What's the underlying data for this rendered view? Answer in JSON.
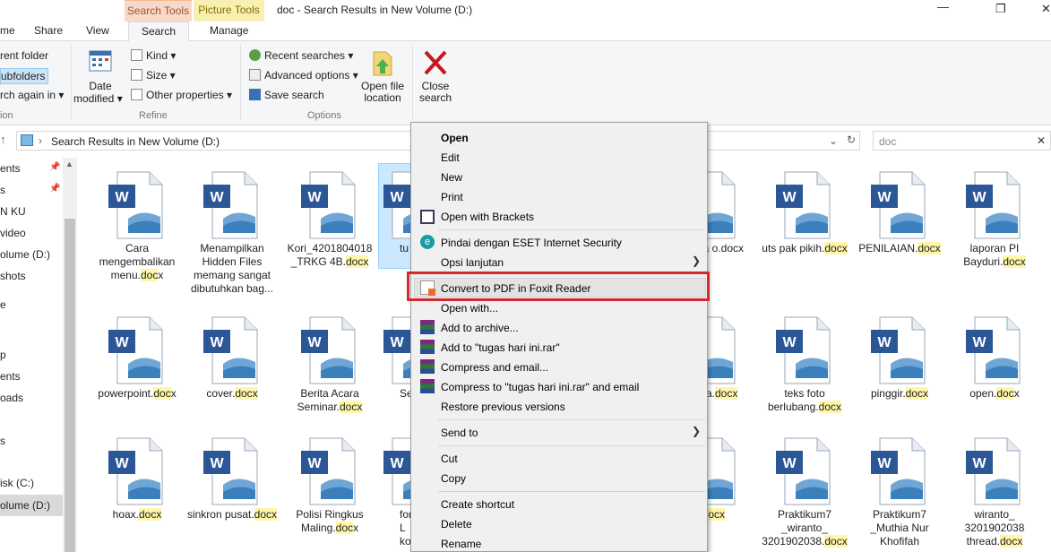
{
  "window": {
    "title": "doc - Search Results in New Volume (D:)",
    "context_tabs": [
      "Search Tools",
      "Picture Tools"
    ]
  },
  "ribbon_tabs": [
    "me",
    "Share",
    "View",
    "Search",
    "Manage"
  ],
  "ribbon": {
    "left_items": [
      "rent folder",
      "ubfolders",
      "rch again in"
    ],
    "left_group": "ion",
    "date_modified": [
      "Date",
      "modified"
    ],
    "refine": [
      "Kind",
      "Size",
      "Other properties"
    ],
    "refine_label": "Refine",
    "options": [
      "Recent searches",
      "Advanced options",
      "Save search"
    ],
    "open_file_location": [
      "Open file",
      "location"
    ],
    "options_label": "Options",
    "close_search": [
      "Close",
      "search"
    ]
  },
  "address": {
    "path": "Search Results in New Volume (D:)",
    "search_value": "doc"
  },
  "nav_items": [
    "ents",
    "s",
    "N KU",
    "video",
    "olume (D:)",
    "shots",
    "e",
    "p",
    "ents",
    "oads",
    "s",
    "isk (C:)",
    "olume (D:)"
  ],
  "files": [
    {
      "pre": "Cara mengembalikan menu.",
      "hl": "doc",
      "post": "x"
    },
    {
      "pre": "Menampilkan Hidden Files memang sangat dibutuhkan bag...",
      "hl": "",
      "post": ""
    },
    {
      "pre": "Kori_4201804018 _TRKG 4B.",
      "hl": "docx",
      "post": ""
    },
    {
      "pre": "tu",
      "hl": "",
      "post": ""
    },
    {
      "pre": "ancsila ",
      "hl": "",
      "post": "o.docx"
    },
    {
      "pre": "uts pak pikih.",
      "hl": "docx",
      "post": ""
    },
    {
      "pre": "PENILAIAN.",
      "hl": "docx",
      "post": ""
    },
    {
      "pre": "laporan PI Bayduri.",
      "hl": "docx",
      "post": ""
    },
    {
      "pre": "powerpoint.",
      "hl": "doc",
      "post": "x"
    },
    {
      "pre": "cover.",
      "hl": "docx",
      "post": ""
    },
    {
      "pre": "Berita Acara Seminar.",
      "hl": "docx",
      "post": ""
    },
    {
      "pre": "Sen",
      "hl": "",
      "post": ""
    },
    {
      "pre": "foto ra.",
      "hl": "docx",
      "post": ""
    },
    {
      "pre": "teks foto berlubang.",
      "hl": "docx",
      "post": ""
    },
    {
      "pre": "pinggir.",
      "hl": "docx",
      "post": ""
    },
    {
      "pre": "open.",
      "hl": "doc",
      "post": "x"
    },
    {
      "pre": "hoax.",
      "hl": "docx",
      "post": ""
    },
    {
      "pre": "sinkron pusat.",
      "hl": "docx",
      "post": ""
    },
    {
      "pre": "Polisi Ringkus Maling.",
      "hl": "doc",
      "post": "x"
    },
    {
      "pre": "forn L konst",
      "hl": "",
      "post": ""
    },
    {
      "pre": "ll.",
      "hl": "docx",
      "post": ""
    },
    {
      "pre": "Praktikum7 _wiranto_ 3201902038.",
      "hl": "docx",
      "post": ""
    },
    {
      "pre": "Praktikum7 _Muthia Nur Khofifah",
      "hl": "",
      "post": ""
    },
    {
      "pre": "wiranto_ 3201902038 thread.",
      "hl": "docx",
      "post": ""
    }
  ],
  "context_menu": [
    "Open",
    "Edit",
    "New",
    "Print",
    "Open with Brackets",
    "Pindai dengan ESET Internet Security",
    "Opsi lanjutan",
    "Convert to PDF in Foxit Reader",
    "Open with...",
    "Add to archive...",
    "Add to \"tugas hari ini.rar\"",
    "Compress and email...",
    "Compress to \"tugas hari ini.rar\" and email",
    "Restore previous versions",
    "Send to",
    "Cut",
    "Copy",
    "Create shortcut",
    "Delete",
    "Rename"
  ],
  "colors": {
    "accent": "#d42a2f",
    "highlight": "#fff6a9",
    "word_blue": "#2b5797"
  }
}
